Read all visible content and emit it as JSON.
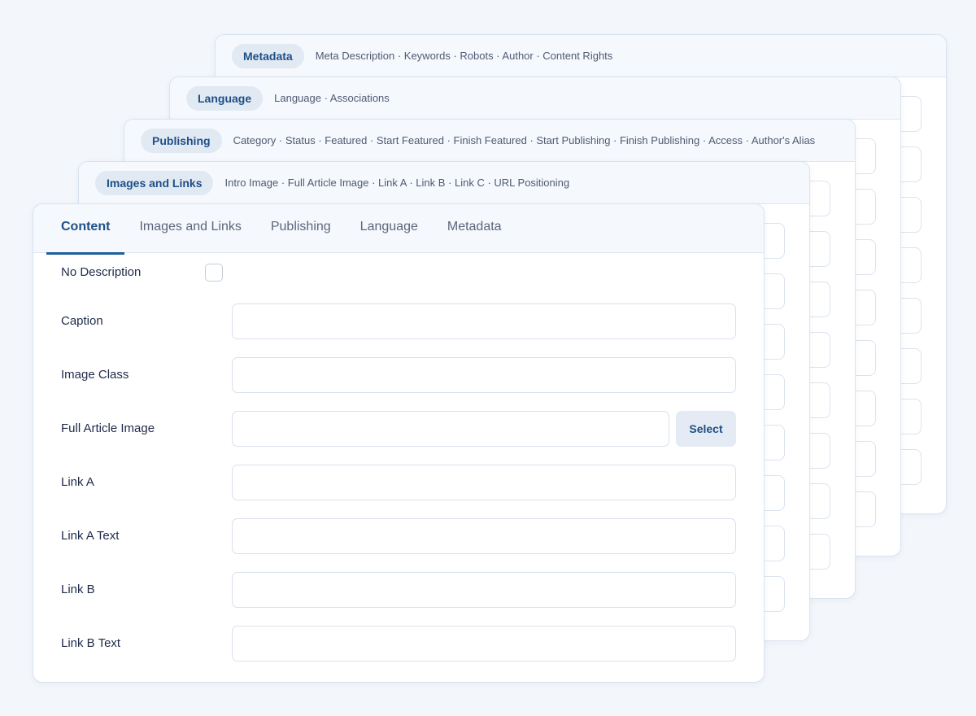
{
  "stack": [
    {
      "pill": "Metadata",
      "fields": "Meta Description · Keywords · Robots · Author · Content Rights"
    },
    {
      "pill": "Language",
      "fields": "Language · Associations"
    },
    {
      "pill": "Publishing",
      "fields": "Category · Status · Featured · Start Featured · Finish Featured · Start Publishing · Finish Publishing · Access · Author's Alias"
    },
    {
      "pill": "Images and Links",
      "fields": "Intro Image · Full Article Image · Link A · Link B · Link C · URL Positioning"
    }
  ],
  "tabs": [
    "Content",
    "Images and Links",
    "Publishing",
    "Language",
    "Metadata"
  ],
  "active_tab": "Content",
  "form": {
    "no_description": {
      "label": "No Description",
      "checked": false
    },
    "caption": {
      "label": "Caption",
      "value": ""
    },
    "image_class": {
      "label": "Image Class",
      "value": ""
    },
    "full_article_image": {
      "label": "Full Article Image",
      "value": "",
      "button": "Select"
    },
    "link_a": {
      "label": "Link A",
      "value": ""
    },
    "link_a_text": {
      "label": "Link A Text",
      "value": ""
    },
    "link_b": {
      "label": "Link B",
      "value": ""
    },
    "link_b_text": {
      "label": "Link B Text",
      "value": ""
    }
  }
}
